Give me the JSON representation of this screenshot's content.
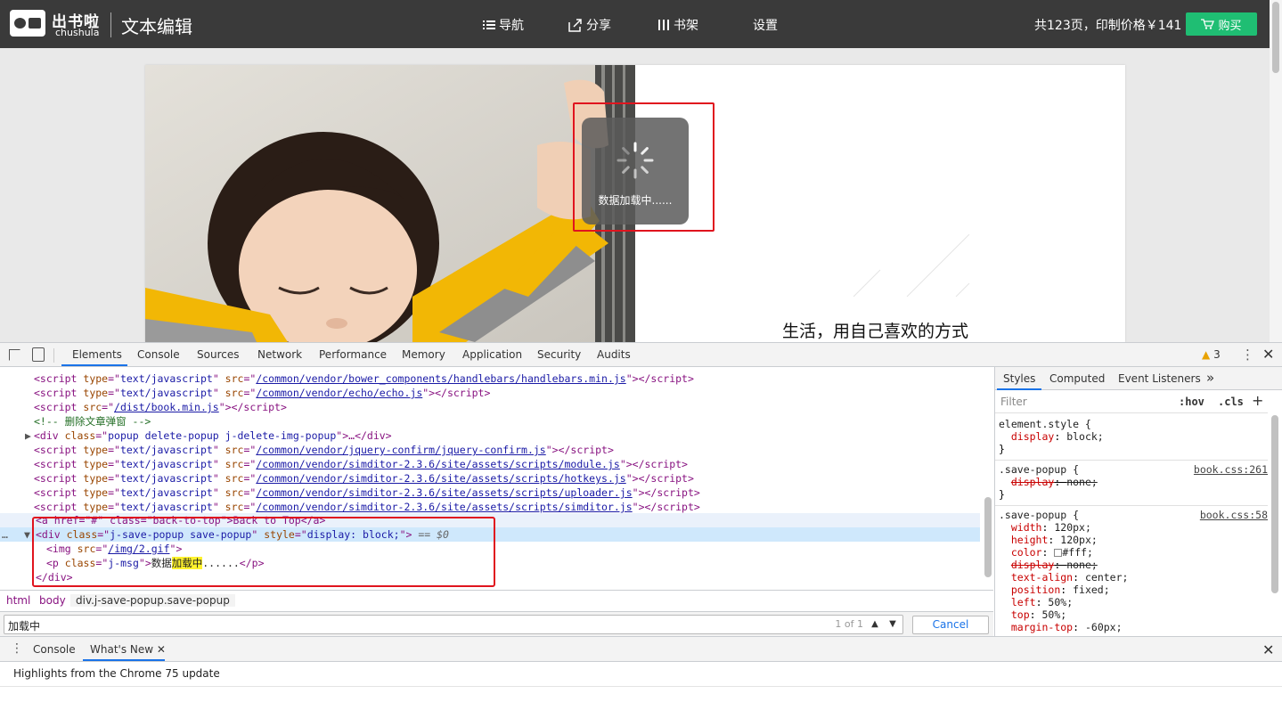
{
  "header": {
    "brand_cn": "出书啦",
    "brand_en": "chushula",
    "app_title": "文本编辑",
    "nav": [
      {
        "label": "导航",
        "icon": "list-icon"
      },
      {
        "label": "分享",
        "icon": "share-icon"
      },
      {
        "label": "书架",
        "icon": "bookshelf-icon"
      },
      {
        "label": "设置",
        "icon": ""
      }
    ],
    "info": "共123页，印制价格￥141",
    "buy_label": "购买",
    "buy_color": "#1fbe73"
  },
  "page": {
    "caption": "生活，用自己喜欢的方式",
    "loading_msg": "数据加载中......"
  },
  "devtools": {
    "tabs": [
      "Elements",
      "Console",
      "Sources",
      "Network",
      "Performance",
      "Memory",
      "Application",
      "Security",
      "Audits"
    ],
    "warnings": "3",
    "code_lines": [
      {
        "kind": "script",
        "src": "/common/vendor/bower_components/handlebars/handlebars.min.js",
        "typed": true
      },
      {
        "kind": "script",
        "src": "/common/vendor/echo/echo.js",
        "typed": true
      },
      {
        "kind": "script",
        "src": "/dist/book.min.js",
        "typed": false
      },
      {
        "kind": "comment",
        "text": "<!-- 删除文章弹窗 -->"
      },
      {
        "kind": "div",
        "text": "popup delete-popup j-delete-img-popup"
      },
      {
        "kind": "script",
        "src": "/common/vendor/jquery-confirm/jquery-confirm.js",
        "typed": true
      },
      {
        "kind": "script",
        "src": "/common/vendor/simditor-2.3.6/site/assets/scripts/module.js",
        "typed": true
      },
      {
        "kind": "script",
        "src": "/common/vendor/simditor-2.3.6/site/assets/scripts/hotkeys.js",
        "typed": true
      },
      {
        "kind": "script",
        "src": "/common/vendor/simditor-2.3.6/site/assets/scripts/uploader.js",
        "typed": true
      },
      {
        "kind": "script",
        "src": "/common/vendor/simditor-2.3.6/site/assets/scripts/simditor.js",
        "typed": true
      }
    ],
    "backtop_line": "<a href=\"#\" class=\"back-to-top\">Back to Top</a>",
    "sel_div_class": "j-save-popup save-popup",
    "sel_div_style": "display: block;",
    "sel_eq": "== $0",
    "img_src": "/img/2.gif",
    "p_class": "j-msg",
    "p_text_before": "数据",
    "p_text_mark": "加载中",
    "p_text_after": "......",
    "close_div": "</div>",
    "breadcrumb": [
      "html",
      "body",
      "div.j-save-popup.save-popup"
    ],
    "search": {
      "query": "加载中",
      "count": "1 of 1",
      "cancel": "Cancel"
    },
    "styles_tabs": [
      "Styles",
      "Computed",
      "Event Listeners"
    ],
    "styles_filter_placeholder": "Filter",
    "styles_hov": ":hov",
    "styles_cls": ".cls",
    "rules": {
      "element_style": {
        "selector": "element.style {",
        "prop": "display",
        "value": "block;"
      },
      "rule1": {
        "selector": ".save-popup {",
        "source": "book.css:261",
        "prop": "display",
        "value": "none;"
      },
      "rule2": {
        "selector": ".save-popup {",
        "source": "book.css:58",
        "props": [
          {
            "prop": "width",
            "value": "120px;",
            "strike": false
          },
          {
            "prop": "height",
            "value": "120px;",
            "strike": false
          },
          {
            "prop": "color",
            "value": "#fff;",
            "strike": false,
            "swatch": true
          },
          {
            "prop": "display",
            "value": "none;",
            "strike": true
          },
          {
            "prop": "text-align",
            "value": "center;",
            "strike": false
          },
          {
            "prop": "position",
            "value": "fixed;",
            "strike": false
          },
          {
            "prop": "left",
            "value": "50%;",
            "strike": false
          },
          {
            "prop": "top",
            "value": "50%;",
            "strike": false
          },
          {
            "prop": "margin-top",
            "value": "-60px;",
            "strike": false
          }
        ]
      }
    },
    "drawer": {
      "tabs": [
        "Console",
        "What's New"
      ],
      "content": "Highlights from the Chrome 75 update"
    }
  }
}
